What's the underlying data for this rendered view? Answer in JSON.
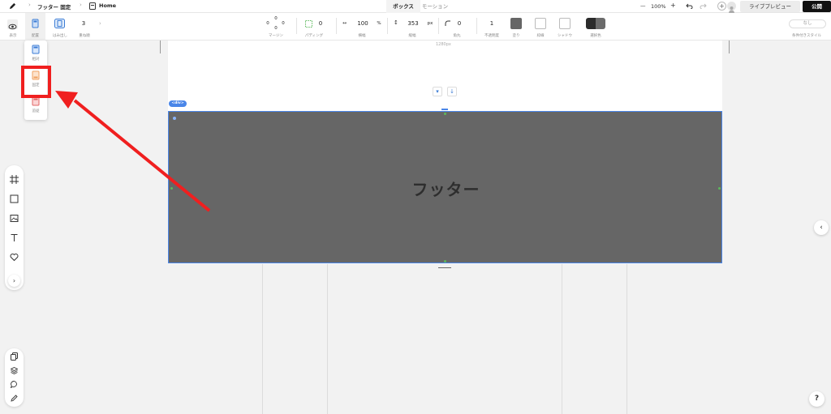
{
  "topbar": {
    "breadcrumb_page": "フッター 固定",
    "breadcrumb_home": "Home",
    "tabs": [
      {
        "label": "ボックス",
        "active": true
      },
      {
        "label": "モーション",
        "active": false
      }
    ],
    "zoom_minus": "—",
    "zoom": "100%",
    "zoom_plus": "+",
    "preview_label": "ライブプレビュー",
    "publish_label": "公開"
  },
  "toolbar": {
    "show_label": "表示",
    "placement_label": "配置",
    "overflow_label": "はみ出し",
    "stack_value": "3",
    "stack_label": "重ね順",
    "margin_top": "0",
    "margin_left": "0",
    "margin_right": "0",
    "margin_bottom": "0",
    "margin_label": "マージン",
    "padding_value": "0",
    "padding_label": "パディング",
    "width_value": "100",
    "width_unit": "%",
    "width_label": "横幅",
    "height_value": "353",
    "height_unit": "px",
    "height_label": "縦幅",
    "radius_value": "0",
    "radius_label": "角丸",
    "opacity_value": "1",
    "opacity_label": "不透明度",
    "fill_label": "塗り",
    "border_label": "枠線",
    "shadow_label": "シャドウ",
    "selection_color_label": "選択色",
    "conditional_value": "なし",
    "conditional_label": "条件付きスタイル",
    "colors": {
      "fill": "#666666",
      "selection_dark": "#2b2b2b",
      "selection_light": "#6b6b6b"
    }
  },
  "placement_dropdown": {
    "items": [
      {
        "label": "相対"
      },
      {
        "label": "固定",
        "highlighted": true
      },
      {
        "label": "追従"
      }
    ]
  },
  "canvas": {
    "ruler_label": "1280px",
    "element_tag": "<div>",
    "footer_text": "フッター",
    "footer_color": "#666666",
    "selection_color": "#4a86e8"
  },
  "annotation": {
    "color": "#f01f1f"
  },
  "left_tools": [
    "frame-icon",
    "square-icon",
    "image-icon",
    "text-icon",
    "heart-icon",
    "chevron-right-icon"
  ],
  "left_tools_bottom": [
    "pages-icon",
    "layers-icon",
    "comment-icon",
    "pencil-icon"
  ],
  "help_label": "?",
  "right_toggle_label": "‹"
}
